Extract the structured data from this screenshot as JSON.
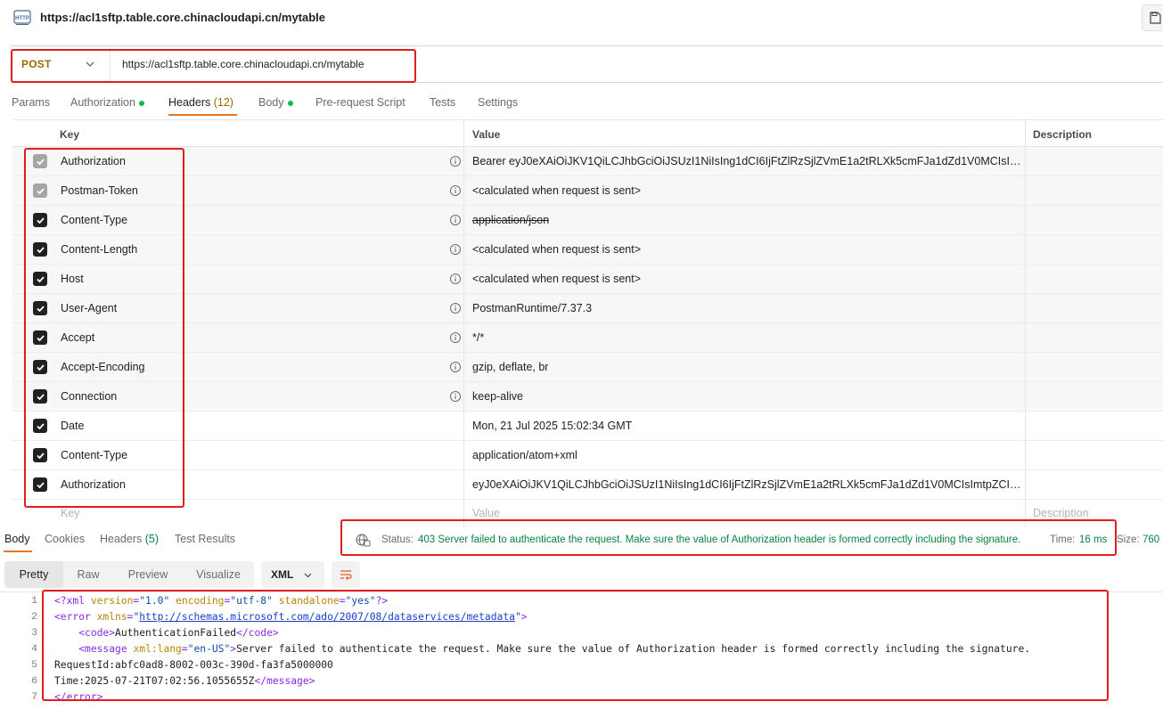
{
  "topbar": {
    "title": "https://acl1sftp.table.core.chinacloudapi.cn/mytable",
    "icon": "http-icon",
    "icon_label": "HTTP"
  },
  "request": {
    "method": "POST",
    "url": "https://acl1sftp.table.core.chinacloudapi.cn/mytable"
  },
  "tabs": [
    {
      "label": "Params",
      "count": "",
      "dot": false
    },
    {
      "label": "Authorization",
      "count": "",
      "dot": true
    },
    {
      "label": "Headers",
      "count": "(12)",
      "dot": false,
      "active": true
    },
    {
      "label": "Body",
      "count": "",
      "dot": true
    },
    {
      "label": "Pre-request Script",
      "count": "",
      "dot": false
    },
    {
      "label": "Tests",
      "count": "",
      "dot": false
    },
    {
      "label": "Settings",
      "count": "",
      "dot": false
    }
  ],
  "table": {
    "col_key": "Key",
    "col_value": "Value",
    "col_description": "Description",
    "rows": [
      {
        "key": "Authorization",
        "value": "Bearer eyJ0eXAiOiJKV1QiLCJhbGciOiJSUzI1NiIsIng1dCI6IjFtZlRzSjlZVmE1a2tRLXk5cmFJa1dZd1V0MCIsImt...",
        "checked": true,
        "disabled": true,
        "info": true,
        "strike": false
      },
      {
        "key": "Postman-Token",
        "value": "<calculated when request is sent>",
        "checked": true,
        "disabled": true,
        "info": true,
        "strike": false
      },
      {
        "key": "Content-Type",
        "value": "application/json",
        "checked": true,
        "disabled": false,
        "info": true,
        "strike": true
      },
      {
        "key": "Content-Length",
        "value": "<calculated when request is sent>",
        "checked": true,
        "disabled": false,
        "info": true,
        "strike": false
      },
      {
        "key": "Host",
        "value": "<calculated when request is sent>",
        "checked": true,
        "disabled": false,
        "info": true,
        "strike": false
      },
      {
        "key": "User-Agent",
        "value": "PostmanRuntime/7.37.3",
        "checked": true,
        "disabled": false,
        "info": true,
        "strike": false
      },
      {
        "key": "Accept",
        "value": "*/*",
        "checked": true,
        "disabled": false,
        "info": true,
        "strike": false
      },
      {
        "key": "Accept-Encoding",
        "value": "gzip, deflate, br",
        "checked": true,
        "disabled": false,
        "info": true,
        "strike": false
      },
      {
        "key": "Connection",
        "value": "keep-alive",
        "checked": true,
        "disabled": false,
        "info": true,
        "strike": false
      },
      {
        "key": "Date",
        "value": "Mon, 21 Jul 2025 15:02:34 GMT",
        "checked": true,
        "disabled": false,
        "info": false,
        "strike": false
      },
      {
        "key": "Content-Type",
        "value": "application/atom+xml",
        "checked": true,
        "disabled": false,
        "info": false,
        "strike": false
      },
      {
        "key": "Authorization",
        "value": "eyJ0eXAiOiJKV1QiLCJhbGciOiJSUzI1NiIsIng1dCI6IjFtZlRzSjlZVmE1a2tRLXk5cmFJa1dZd1V0MCIsImtpZCI6Ij...",
        "checked": true,
        "disabled": false,
        "info": false,
        "strike": false
      }
    ],
    "placeholder_key": "Key",
    "placeholder_value": "Value",
    "placeholder_description": "Description"
  },
  "response": {
    "tabs": [
      {
        "label": "Body",
        "count": "",
        "active": true
      },
      {
        "label": "Cookies",
        "count": ""
      },
      {
        "label": "Headers",
        "count": "(5)"
      },
      {
        "label": "Test Results",
        "count": ""
      }
    ],
    "status_label": "Status:",
    "status_value": "403 Server failed to authenticate the request. Make sure the value of Authorization header is formed correctly including the signature.",
    "time_label": "Time:",
    "time_value": "16 ms",
    "size_label": "Size:",
    "size_value": "760",
    "views": [
      "Pretty",
      "Raw",
      "Preview",
      "Visualize"
    ],
    "active_view": "Pretty",
    "format": "XML",
    "code_lines": [
      {
        "n": "1",
        "parts": [
          [
            "tag",
            "<?xml "
          ],
          [
            "attr",
            "version"
          ],
          [
            "tag",
            "="
          ],
          [
            "str",
            "\"1.0\""
          ],
          [
            "tag",
            " "
          ],
          [
            "attr",
            "encoding"
          ],
          [
            "tag",
            "="
          ],
          [
            "str",
            "\"utf-8\""
          ],
          [
            "tag",
            " "
          ],
          [
            "attr",
            "standalone"
          ],
          [
            "tag",
            "="
          ],
          [
            "str",
            "\"yes\""
          ],
          [
            "tag",
            "?>"
          ]
        ]
      },
      {
        "n": "2",
        "parts": [
          [
            "tag",
            "<error "
          ],
          [
            "attr",
            "xmlns"
          ],
          [
            "tag",
            "="
          ],
          [
            "str",
            "\""
          ],
          [
            "link",
            "http://schemas.microsoft.com/ado/2007/08/dataservices/metadata"
          ],
          [
            "str",
            "\""
          ],
          [
            "tag",
            ">"
          ]
        ]
      },
      {
        "n": "3",
        "parts": [
          [
            "plain",
            "    "
          ],
          [
            "tag",
            "<code>"
          ],
          [
            "plain",
            "AuthenticationFailed"
          ],
          [
            "tag",
            "</code>"
          ]
        ]
      },
      {
        "n": "4",
        "parts": [
          [
            "plain",
            "    "
          ],
          [
            "tag",
            "<message "
          ],
          [
            "attr",
            "xml:lang"
          ],
          [
            "tag",
            "="
          ],
          [
            "str",
            "\"en-US\""
          ],
          [
            "tag",
            ">"
          ],
          [
            "plain",
            "Server failed to authenticate the request. Make sure the value of Authorization header is formed correctly including the signature."
          ]
        ]
      },
      {
        "n": "5",
        "parts": [
          [
            "plain",
            "RequestId:abfc0ad8-8002-003c-390d-fa3fa5000000"
          ]
        ]
      },
      {
        "n": "6",
        "parts": [
          [
            "plain",
            "Time:2025-07-21T07:02:56.1055655Z"
          ],
          [
            "tag",
            "</message>"
          ]
        ]
      },
      {
        "n": "7",
        "parts": [
          [
            "tag",
            "</error>"
          ]
        ]
      }
    ]
  }
}
